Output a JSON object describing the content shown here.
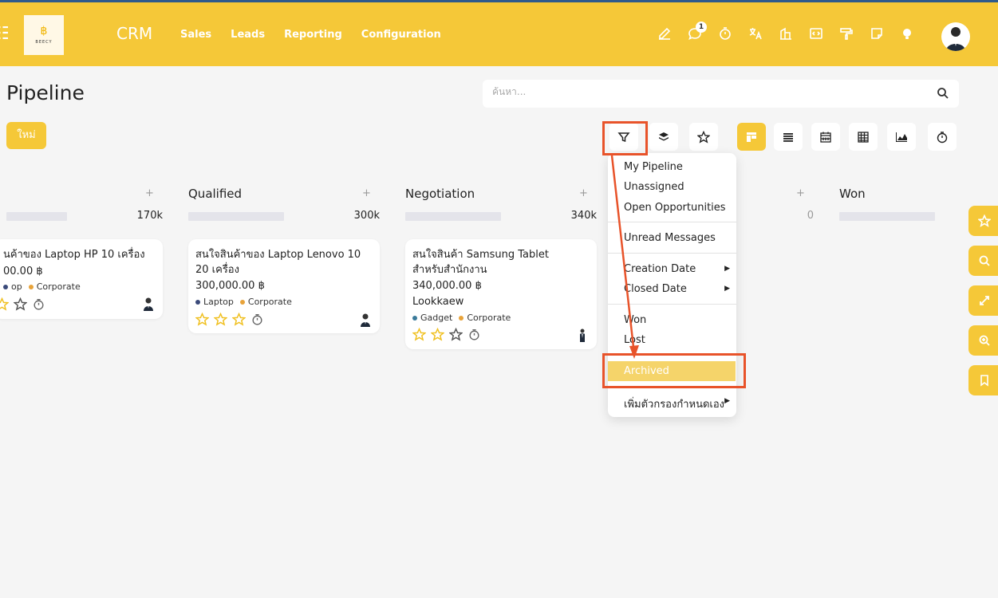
{
  "navbar": {
    "app_title": "CRM",
    "menu": [
      "Sales",
      "Leads",
      "Reporting",
      "Configuration"
    ],
    "logo_text": "BEECY",
    "messages_badge": "1",
    "icons": [
      "edit-icon",
      "chat-icon",
      "timer-icon",
      "translate-icon",
      "building-icon",
      "code-icon",
      "paint-roller-icon",
      "note-icon",
      "lightbulb-icon"
    ]
  },
  "control": {
    "title": "Pipeline",
    "search_placeholder": "ค้นหา...",
    "new_label": "ใหม่"
  },
  "columns": [
    {
      "name": "",
      "total": "170k"
    },
    {
      "name": "Qualified",
      "total": "300k"
    },
    {
      "name": "Negotiation",
      "total": "340k"
    },
    {
      "name": "",
      "total": "0"
    },
    {
      "name": "Won",
      "total": ""
    }
  ],
  "cards": [
    {
      "title": "นค้าของ Laptop HP 10 เครื่อง",
      "amount": "00.00 ฿",
      "tags": [
        {
          "label": "op",
          "color": "#3a4a7a"
        },
        {
          "label": "Corporate",
          "color": "#e8a33a"
        }
      ],
      "stars_filled": 1
    },
    {
      "title": "สนใจสินค้าของ Laptop Lenovo 10 20 เครื่อง",
      "amount": "300,000.00 ฿",
      "tags": [
        {
          "label": "Laptop",
          "color": "#3a4a7a"
        },
        {
          "label": "Corporate",
          "color": "#e8a33a"
        }
      ],
      "stars_filled": 0
    },
    {
      "title": "สนใจสินค้า Samsung Tablet สำหรับสำนักงาน",
      "amount": "340,000.00 ฿",
      "person": "Lookkaew",
      "tags": [
        {
          "label": "Gadget",
          "color": "#3a7a9a"
        },
        {
          "label": "Corporate",
          "color": "#e8a33a"
        }
      ],
      "stars_filled": 0
    }
  ],
  "filter_menu": {
    "items": [
      "My Pipeline",
      "Unassigned",
      "Open Opportunities",
      "Unread Messages",
      "Creation Date",
      "Closed Date",
      "Won",
      "Lost",
      "Archived",
      "เพิ่มตัวกรองกำหนดเอง"
    ],
    "highlighted": "Archived"
  },
  "colors": {
    "brand": "#f5c838",
    "annotation": "#e8532a"
  }
}
